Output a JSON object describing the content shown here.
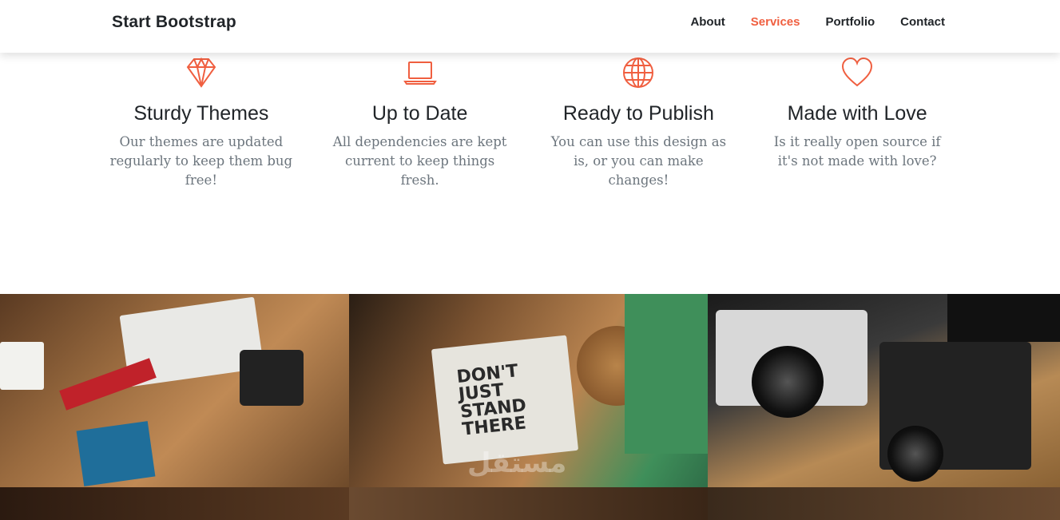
{
  "navbar": {
    "brand": "Start Bootstrap",
    "links": [
      {
        "label": "About",
        "active": false
      },
      {
        "label": "Services",
        "active": true
      },
      {
        "label": "Portfolio",
        "active": false
      },
      {
        "label": "Contact",
        "active": false
      }
    ]
  },
  "services": [
    {
      "icon": "diamond-icon",
      "title": "Sturdy Themes",
      "text": "Our themes are updated regularly to keep them bug free!"
    },
    {
      "icon": "laptop-icon",
      "title": "Up to Date",
      "text": "All dependencies are kept current to keep things fresh."
    },
    {
      "icon": "globe-icon",
      "title": "Ready to Publish",
      "text": "You can use this design as is, or you can make changes!"
    },
    {
      "icon": "heart-icon",
      "title": "Made with Love",
      "text": "Is it really open source if it's not made with love?"
    }
  ],
  "portfolio": {
    "tile2_text": "DON'T JUST STAND THERE",
    "watermark": "مستقل"
  },
  "colors": {
    "accent": "#f05f40",
    "heading": "#212529",
    "muted": "#6c757d"
  }
}
